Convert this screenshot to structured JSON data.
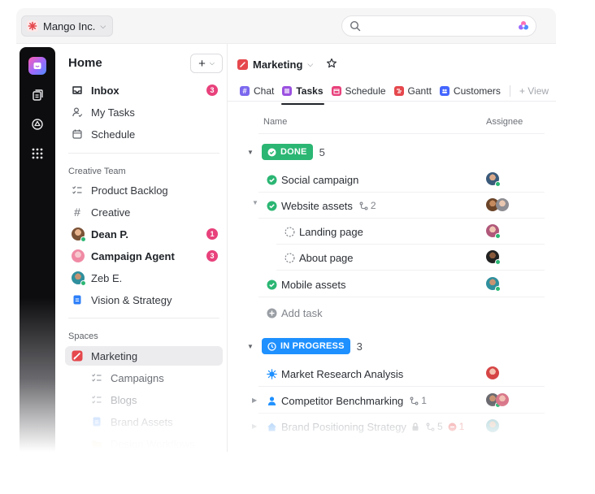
{
  "workspace": {
    "name": "Mango Inc."
  },
  "search": {
    "placeholder": ""
  },
  "sidebar": {
    "title": "Home",
    "add_label": "+",
    "top_items": [
      {
        "label": "Inbox",
        "badge": "3",
        "icon": "inbox-icon"
      },
      {
        "label": "My Tasks",
        "icon": "user-tasks-icon"
      },
      {
        "label": "Schedule",
        "icon": "calendar-icon"
      }
    ],
    "team_section": "Creative Team",
    "team_items": [
      {
        "label": "Product Backlog",
        "icon": "checklist-icon"
      },
      {
        "label": "Creative",
        "icon": "hash-icon"
      },
      {
        "label": "Dean P.",
        "badge": "1",
        "icon": "avatar"
      },
      {
        "label": "Campaign Agent",
        "badge": "3",
        "icon": "avatar"
      },
      {
        "label": "Zeb E.",
        "icon": "avatar"
      },
      {
        "label": "Vision & Strategy",
        "icon": "doc-icon"
      }
    ],
    "spaces_section": "Spaces",
    "space_items": [
      {
        "label": "Marketing",
        "icon": "space-icon",
        "active": true
      },
      {
        "label": "Campaigns",
        "icon": "checklist-icon"
      },
      {
        "label": "Blogs",
        "icon": "checklist-icon"
      },
      {
        "label": "Brand Assets",
        "icon": "doc-icon"
      },
      {
        "label": "Design Workflows",
        "icon": "folder-icon"
      }
    ]
  },
  "main": {
    "title": "Marketing",
    "tabs": [
      {
        "label": "Chat",
        "color": "#7b68ee"
      },
      {
        "label": "Tasks",
        "color": "#9b51e0",
        "active": true
      },
      {
        "label": "Schedule",
        "color": "#e8417b"
      },
      {
        "label": "Gantt",
        "color": "#e5484d"
      },
      {
        "label": "Customers",
        "color": "#4466ff"
      }
    ],
    "view_label": "+ View",
    "columns": {
      "name": "Name",
      "assignee": "Assignee"
    },
    "done_group": {
      "label": "DONE",
      "count": "5",
      "color": "#2bb673",
      "tasks": [
        {
          "name": "Social campaign"
        },
        {
          "name": "Website assets",
          "subtasks": "2"
        },
        {
          "name": "Landing page"
        },
        {
          "name": "About page"
        },
        {
          "name": "Mobile assets"
        }
      ]
    },
    "add_task_label": "Add task",
    "progress_group": {
      "label": "IN PROGRESS",
      "count": "3",
      "color": "#1e90ff",
      "tasks": [
        {
          "name": "Market Research Analysis"
        },
        {
          "name": "Competitor Benchmarking",
          "subtasks": "1"
        },
        {
          "name": "Brand Positioning Strategy",
          "subtasks": "5",
          "blocked": "1"
        }
      ]
    }
  }
}
